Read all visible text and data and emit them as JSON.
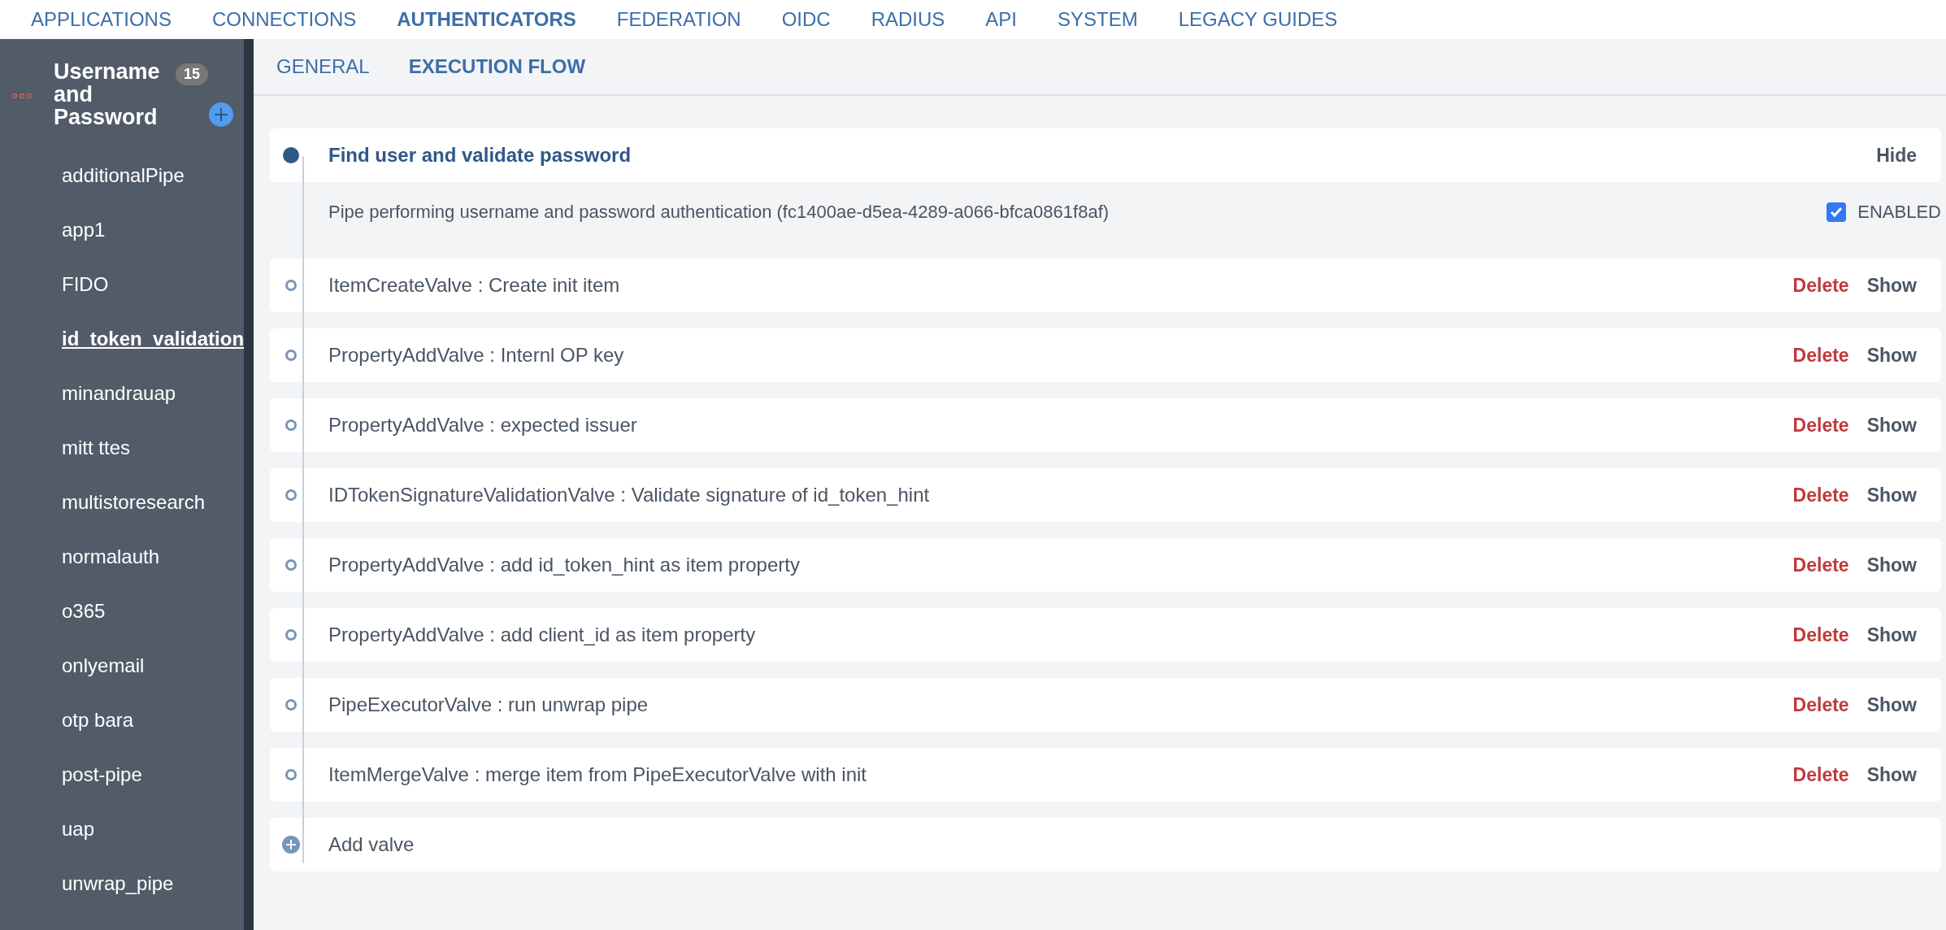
{
  "nav": [
    {
      "label": "APPLICATIONS",
      "selected": false
    },
    {
      "label": "CONNECTIONS",
      "selected": false
    },
    {
      "label": "AUTHENTICATORS",
      "selected": true
    },
    {
      "label": "FEDERATION",
      "selected": false
    },
    {
      "label": "OIDC",
      "selected": false
    },
    {
      "label": "RADIUS",
      "selected": false
    },
    {
      "label": "API",
      "selected": false
    },
    {
      "label": "SYSTEM",
      "selected": false
    },
    {
      "label": "LEGACY GUIDES",
      "selected": false
    }
  ],
  "sidebar": {
    "title": "Username and Password",
    "count": "15",
    "items": [
      {
        "label": "additionalPipe",
        "selected": false
      },
      {
        "label": "app1",
        "selected": false
      },
      {
        "label": "FIDO",
        "selected": false
      },
      {
        "label": "id_token_validation",
        "selected": true
      },
      {
        "label": "minandrauap",
        "selected": false
      },
      {
        "label": "mitt ttes",
        "selected": false
      },
      {
        "label": "multistoresearch",
        "selected": false
      },
      {
        "label": "normalauth",
        "selected": false
      },
      {
        "label": "o365",
        "selected": false
      },
      {
        "label": "onlyemail",
        "selected": false
      },
      {
        "label": "otp bara",
        "selected": false
      },
      {
        "label": "post-pipe",
        "selected": false
      },
      {
        "label": "uap",
        "selected": false
      },
      {
        "label": "unwrap_pipe",
        "selected": false
      }
    ]
  },
  "subtabs": [
    {
      "label": "GENERAL",
      "selected": false
    },
    {
      "label": "EXECUTION FLOW",
      "selected": true
    }
  ],
  "pipe": {
    "title": "Find user and validate password",
    "toggle": "Hide",
    "description": "Pipe performing username and password authentication (fc1400ae-d5ea-4289-a066-bfca0861f8af)",
    "enabled_label": "ENABLED",
    "enabled": true
  },
  "valves": [
    {
      "label": "ItemCreateValve : Create init item",
      "delete": "Delete",
      "toggle": "Show"
    },
    {
      "label": "PropertyAddValve : Internl OP key",
      "delete": "Delete",
      "toggle": "Show"
    },
    {
      "label": "PropertyAddValve : expected issuer",
      "delete": "Delete",
      "toggle": "Show"
    },
    {
      "label": "IDTokenSignatureValidationValve : Validate signature of id_token_hint",
      "delete": "Delete",
      "toggle": "Show"
    },
    {
      "label": "PropertyAddValve : add id_token_hint as item property",
      "delete": "Delete",
      "toggle": "Show"
    },
    {
      "label": "PropertyAddValve : add client_id as item property",
      "delete": "Delete",
      "toggle": "Show"
    },
    {
      "label": "PipeExecutorValve : run unwrap pipe",
      "delete": "Delete",
      "toggle": "Show"
    },
    {
      "label": "ItemMergeValve : merge item from PipeExecutorValve with init",
      "delete": "Delete",
      "toggle": "Show"
    }
  ],
  "add_valve": "Add valve"
}
